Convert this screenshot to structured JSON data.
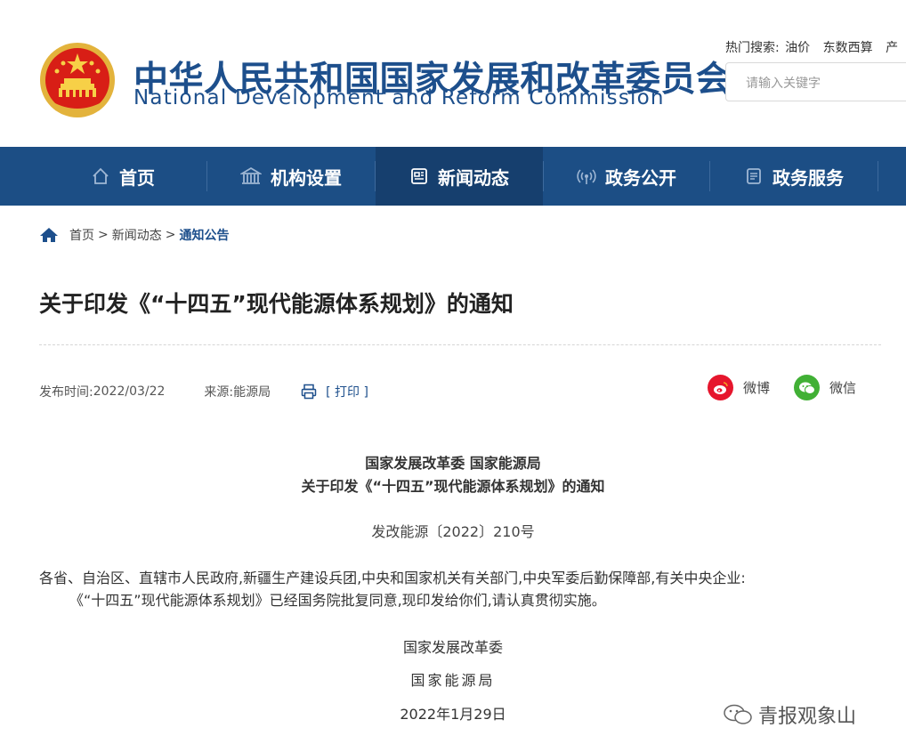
{
  "header": {
    "site_name_cn": "中华人民共和国国家发展和改革委员会",
    "site_name_en": "National Development and Reform Commission",
    "hot_search": {
      "label": "热门搜索:",
      "items": [
        "油价",
        "东数西算",
        "产"
      ]
    },
    "search_placeholder": "请输入关键字"
  },
  "nav": {
    "items": [
      {
        "label": "首页",
        "icon": "home-icon"
      },
      {
        "label": "机构设置",
        "icon": "building-icon"
      },
      {
        "label": "新闻动态",
        "icon": "news-icon",
        "active": true
      },
      {
        "label": "政务公开",
        "icon": "broadcast-icon"
      },
      {
        "label": "政务服务",
        "icon": "document-icon"
      }
    ]
  },
  "breadcrumb": {
    "items": [
      "首页",
      "新闻动态",
      "通知公告"
    ],
    "separator": ">"
  },
  "article": {
    "title": "关于印发《“十四五”现代能源体系规划》的通知",
    "publish_label": "发布时间:",
    "publish_date": "2022/03/22",
    "source_label": "来源:",
    "source": "能源局",
    "print_label": "[ 打印 ]",
    "share": [
      {
        "label": "微博",
        "icon": "weibo-icon",
        "color": "#e6162d"
      },
      {
        "label": "微信",
        "icon": "wechat-icon",
        "color": "#41b035"
      }
    ],
    "issuer": "国家发展改革委 国家能源局",
    "notice_title": "关于印发《“十四五”现代能源体系规划》的通知",
    "doc_number": "发改能源〔2022〕210号",
    "recipients": "各省、自治区、直辖市人民政府,新疆生产建设兵团,中央和国家机关有关部门,中央军委后勤保障部,有关中央企业:",
    "paragraph": "《“十四五”现代能源体系规划》已经国务院批复同意,现印发给你们,请认真贯彻实施。",
    "signatures": [
      "国家发展改革委",
      "国家能源局"
    ],
    "sign_date": "2022年1月29日"
  },
  "watermark": "青报观象山",
  "colors": {
    "brand": "#1d4f8c",
    "nav_bg": "#1c4e85",
    "nav_active": "#163f6e"
  }
}
